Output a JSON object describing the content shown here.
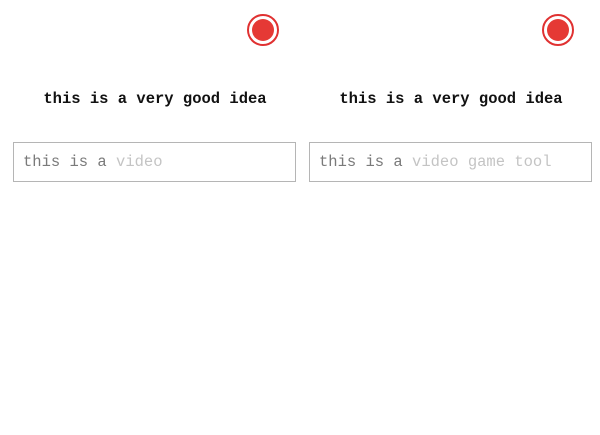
{
  "colors": {
    "record_accent": "#e53935",
    "typed_text": "#7a7a7a",
    "suggestion_text": "#c4c4c4",
    "field_border": "#b5b5b5"
  },
  "panels": [
    {
      "record_icon": "record-icon",
      "headline": "this is a very good idea",
      "input": {
        "typed": "this is a ",
        "suggestion": "video"
      }
    },
    {
      "record_icon": "record-icon",
      "headline": "this is a very good idea",
      "input": {
        "typed": "this is a ",
        "suggestion": "video game tool"
      }
    }
  ]
}
